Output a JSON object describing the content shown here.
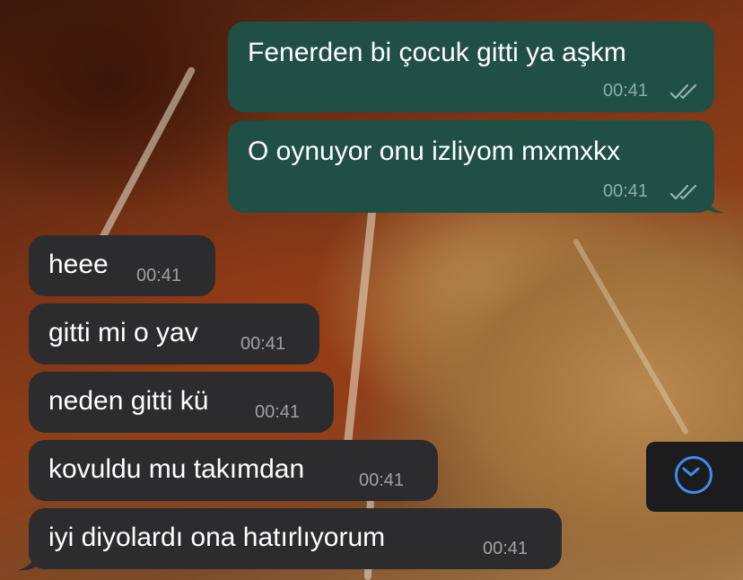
{
  "chat": {
    "outgoing": [
      {
        "text": "Fenerden bi çocuk gitti ya aşkm",
        "time": "00:41"
      },
      {
        "text": "O oynuyor onu izliyom mxmxkx",
        "time": "00:41"
      }
    ],
    "incoming": [
      {
        "text": "heee",
        "time": "00:41"
      },
      {
        "text": "gitti mi o yav",
        "time": "00:41"
      },
      {
        "text": "neden gitti kü",
        "time": "00:41"
      },
      {
        "text": "kovuldu mu takımdan",
        "time": "00:41"
      },
      {
        "text": "iyi diyolardı ona hatırlıyorum",
        "time": "00:41"
      }
    ]
  },
  "icons": {
    "read_receipt": "double-check-icon",
    "scroll_down": "chevron-down-circle-icon"
  },
  "colors": {
    "outgoing_bubble": "#1f4f45",
    "incoming_bubble": "#2c2c2e",
    "scroll_accent": "#3d8cf0"
  }
}
